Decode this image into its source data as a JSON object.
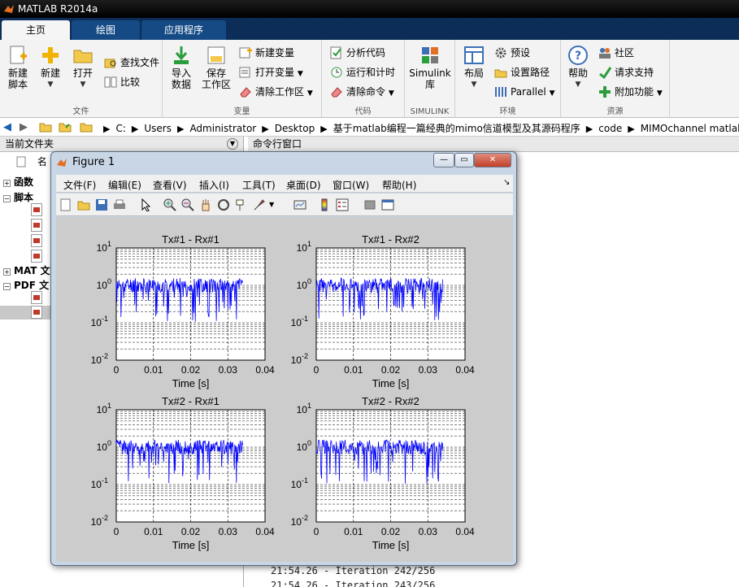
{
  "app": {
    "title": "MATLAB R2014a"
  },
  "tabs": [
    {
      "label": "主页",
      "active": true
    },
    {
      "label": "绘图",
      "active": false
    },
    {
      "label": "应用程序",
      "active": false
    }
  ],
  "ribbon": {
    "file": {
      "label": "文件",
      "new_script_1": "新建",
      "new_script_2": "脚本",
      "new": "新建",
      "open": "打开",
      "find_files": "查找文件",
      "compare": "比较"
    },
    "variable": {
      "label": "变量",
      "import_1": "导入",
      "import_2": "数据",
      "save_ws_1": "保存",
      "save_ws_2": "工作区",
      "new_var": "新建变量",
      "open_var": "打开变量",
      "clear_ws": "清除工作区"
    },
    "code": {
      "label": "代码",
      "analyze": "分析代码",
      "run_time": "运行和计时",
      "clear_cmd": "清除命令"
    },
    "simulink": {
      "label": "SIMULINK",
      "lib_1": "Simulink",
      "lib_2": "库"
    },
    "env": {
      "label": "环境",
      "layout": "布局",
      "prefs": "预设",
      "set_path": "设置路径",
      "parallel": "Parallel"
    },
    "resources": {
      "label": "资源",
      "help": "帮助",
      "community": "社区",
      "support": "请求支持",
      "addons": "附加功能"
    }
  },
  "address": {
    "crumbs": [
      "C:",
      "Users",
      "Administrator",
      "Desktop",
      "基于matlab编程一篇经典的mimo信道模型及其源码程序",
      "code",
      "MIMOchannel matlab"
    ]
  },
  "left_panel": {
    "title": "当前文件夹",
    "name_col": "名",
    "tree": [
      {
        "pm": "+",
        "label": "函数"
      },
      {
        "pm": "−",
        "label": "脚本"
      },
      {
        "pm": "+",
        "label": "MAT 文"
      },
      {
        "pm": "−",
        "label": "PDF 文"
      }
    ]
  },
  "command_panel": {
    "title": "命令行窗口",
    "lines": [
      "21:54.26 - Iteration 242/256",
      "21:54.26 - Iteration 243/256"
    ]
  },
  "figure": {
    "title": "Figure 1",
    "menu": [
      "文件(F)",
      "编辑(E)",
      "查看(V)",
      "插入(I)",
      "工具(T)",
      "桌面(D)",
      "窗口(W)",
      "帮助(H)"
    ]
  },
  "chart_data": [
    {
      "type": "line",
      "title": "Tx#1 - Rx#1",
      "xlabel": "Time [s]",
      "ylabel": "",
      "xlim": [
        0,
        0.04
      ],
      "ylim": [
        0.01,
        10
      ],
      "yscale": "log",
      "xticks": [
        "0",
        "0.01",
        "0.02",
        "0.03",
        "0.04"
      ],
      "yticks": [
        "10^-2",
        "10^-1",
        "10^0",
        "10^1"
      ],
      "grid": true,
      "color": "#0000ff",
      "x_end": 0.034,
      "seed": 11
    },
    {
      "type": "line",
      "title": "Tx#1 - Rx#2",
      "xlabel": "Time [s]",
      "ylabel": "",
      "xlim": [
        0,
        0.04
      ],
      "ylim": [
        0.01,
        10
      ],
      "yscale": "log",
      "xticks": [
        "0",
        "0.01",
        "0.02",
        "0.03",
        "0.04"
      ],
      "yticks": [
        "10^-2",
        "10^-1",
        "10^0",
        "10^1"
      ],
      "grid": true,
      "color": "#0000ff",
      "x_end": 0.034,
      "seed": 23
    },
    {
      "type": "line",
      "title": "Tx#2 - Rx#1",
      "xlabel": "Time [s]",
      "ylabel": "",
      "xlim": [
        0,
        0.04
      ],
      "ylim": [
        0.01,
        10
      ],
      "yscale": "log",
      "xticks": [
        "0",
        "0.01",
        "0.02",
        "0.03",
        "0.04"
      ],
      "yticks": [
        "10^-2",
        "10^-1",
        "10^0",
        "10^1"
      ],
      "grid": true,
      "color": "#0000ff",
      "x_end": 0.034,
      "seed": 37
    },
    {
      "type": "line",
      "title": "Tx#2 - Rx#2",
      "xlabel": "Time [s]",
      "ylabel": "",
      "xlim": [
        0,
        0.04
      ],
      "ylim": [
        0.01,
        10
      ],
      "yscale": "log",
      "xticks": [
        "0",
        "0.01",
        "0.02",
        "0.03",
        "0.04"
      ],
      "yticks": [
        "10^-2",
        "10^-1",
        "10^0",
        "10^1"
      ],
      "grid": true,
      "color": "#0000ff",
      "x_end": 0.034,
      "seed": 51
    }
  ]
}
